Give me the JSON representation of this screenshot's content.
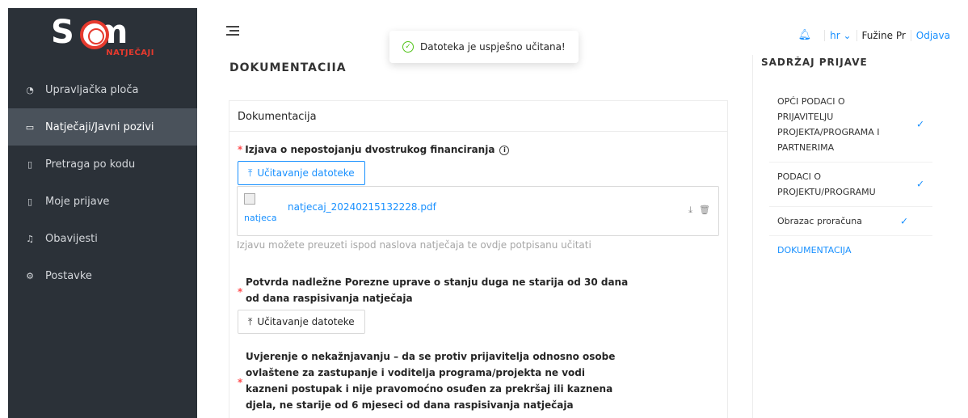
{
  "logo": {
    "text": "S m",
    "subtitle": "NATJEČAJI"
  },
  "sidebar": {
    "items": [
      {
        "label": "Upravljačka ploča",
        "icon": "dashboard-icon"
      },
      {
        "label": "Natječaji/Javni pozivi",
        "icon": "folder-open-icon"
      },
      {
        "label": "Pretraga po kodu",
        "icon": "file-search-icon"
      },
      {
        "label": "Moje prijave",
        "icon": "file-text-icon"
      },
      {
        "label": "Obavijesti",
        "icon": "bell-icon"
      },
      {
        "label": "Postavke",
        "icon": "settings-icon"
      }
    ],
    "active_index": 1
  },
  "topbar": {
    "language": "hr",
    "user": "Fužine Pr",
    "logout": "Odjava"
  },
  "toast": {
    "message": "Datoteka je uspješno učitana!"
  },
  "page": {
    "heading": "DOKUMENTACIJA"
  },
  "card": {
    "title": "Dokumentacija",
    "fields": [
      {
        "label": "Izjava o nepostojanju dvostrukog financiranja",
        "button": "Učitavanje datoteke",
        "file_name": "natjecaj_20240215132228.pdf",
        "thumb_alt": "natjecaj",
        "hint": "Izjavu možete preuzeti ispod naslova natječaja te ovdje potpisanu učitati"
      },
      {
        "label_line1": "Potvrda nadležne Porezne uprave o stanju duga ne starija od 30 dana",
        "label_line2": "od dana raspisivanja natječaja",
        "button": "Učitavanje datoteke"
      },
      {
        "label_line1": "Uvjerenje o nekažnjavanju – da se protiv prijavitelja odnosno osobe",
        "label_line2": "ovlaštene za zastupanje i voditelja programa/projekta ne vodi",
        "label_line3": "kazneni postupak i nije pravomoćno osuđen za prekršaj ili kaznena",
        "label_line4": "djela, ne starije od 6 mjeseci od dana raspisivanja natječaja"
      }
    ]
  },
  "right_panel": {
    "heading": "SADRŽAJ PRIJAVE",
    "steps": [
      {
        "label": "OPĆI PODACI O PRIJAVITELJU PROJEKTA/PROGRAMA I PARTNERIMA",
        "done": true
      },
      {
        "label": "PODACI O PROJEKTU/PROGRAMU",
        "done": true
      },
      {
        "label": "Obrazac proračuna",
        "done": true
      },
      {
        "label": "DOKUMENTACIJA",
        "done": false
      }
    ]
  },
  "colors": {
    "sidebar_bg": "#2b3138",
    "accent": "#1890ff",
    "brand_red": "#e63a2e",
    "success": "#52c41a"
  }
}
